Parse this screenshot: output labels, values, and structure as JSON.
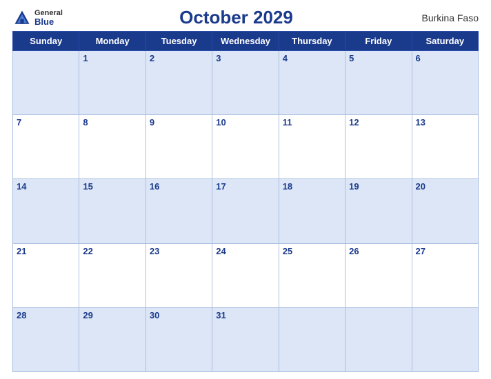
{
  "header": {
    "logo_general": "General",
    "logo_blue": "Blue",
    "title": "October 2029",
    "country": "Burkina Faso"
  },
  "weekdays": [
    "Sunday",
    "Monday",
    "Tuesday",
    "Wednesday",
    "Thursday",
    "Friday",
    "Saturday"
  ],
  "weeks": [
    [
      "",
      "1",
      "2",
      "3",
      "4",
      "5",
      "6"
    ],
    [
      "7",
      "8",
      "9",
      "10",
      "11",
      "12",
      "13"
    ],
    [
      "14",
      "15",
      "16",
      "17",
      "18",
      "19",
      "20"
    ],
    [
      "21",
      "22",
      "23",
      "24",
      "25",
      "26",
      "27"
    ],
    [
      "28",
      "29",
      "30",
      "31",
      "",
      "",
      ""
    ]
  ]
}
